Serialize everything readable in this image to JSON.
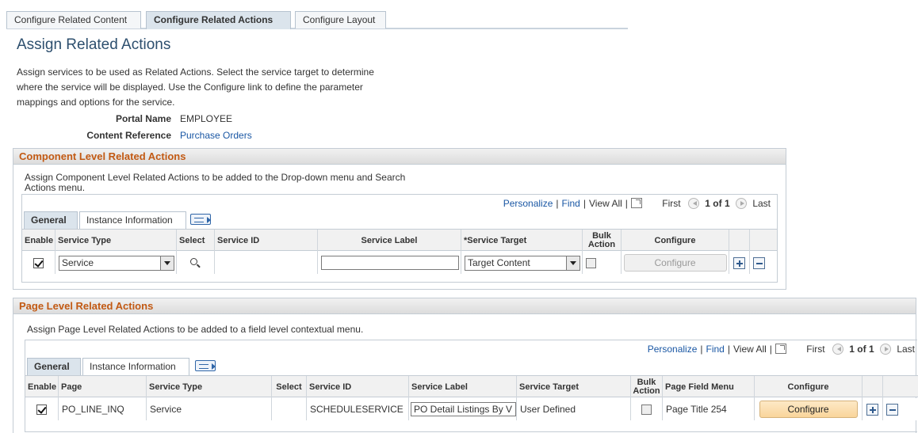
{
  "top_tabs": [
    "Configure Related Content",
    "Configure Related Actions",
    "Configure Layout"
  ],
  "page_title": "Assign Related Actions",
  "description": "Assign services to be used as Related Actions. Select the service target to determine where the service will be displayed. Use the Configure link to define the parameter mappings and options for the service.",
  "portal_name_label": "Portal Name",
  "portal_name_value": "EMPLOYEE",
  "content_ref_label": "Content Reference",
  "content_ref_value": "Purchase Orders",
  "navbar": {
    "personalize": "Personalize",
    "find": "Find",
    "view_all": "View All",
    "sep": "|",
    "first": "First",
    "count": "1 of 1",
    "last": "Last"
  },
  "grid_tabs": {
    "general": "General",
    "instance": "Instance Information"
  },
  "component": {
    "title": "Component Level Related Actions",
    "desc": "Assign Component Level Related Actions to be added to the Drop-down menu and Search Actions menu.",
    "headers": {
      "enable": "Enable",
      "service_type": "Service Type",
      "select": "Select",
      "service_id": "Service ID",
      "service_label": "Service Label",
      "service_target": "*Service Target",
      "bulk_action": "Bulk Action",
      "configure": "Configure"
    },
    "row": {
      "enabled": true,
      "service_type": "Service",
      "service_id": "",
      "service_label": "",
      "service_target": "Target Content",
      "bulk_action": false,
      "configure": "Configure"
    }
  },
  "page_level": {
    "title": "Page Level Related Actions",
    "desc": "Assign Page Level Related Actions to be added to a field level contextual menu.",
    "headers": {
      "enable": "Enable",
      "page": "Page",
      "service_type": "Service Type",
      "select": "Select",
      "service_id": "Service ID",
      "service_label": "Service Label",
      "service_target": "Service Target",
      "bulk_action": "Bulk Action",
      "page_field_menu": "Page Field Menu",
      "configure": "Configure"
    },
    "row": {
      "enabled": true,
      "page": "PO_LINE_INQ",
      "service_type": "Service",
      "service_id": "SCHEDULESERVICE",
      "service_label": "PO Detail Listings By V",
      "service_target": "User Defined",
      "bulk_action": false,
      "page_field_menu": "Page Title 254",
      "configure": "Configure"
    }
  }
}
